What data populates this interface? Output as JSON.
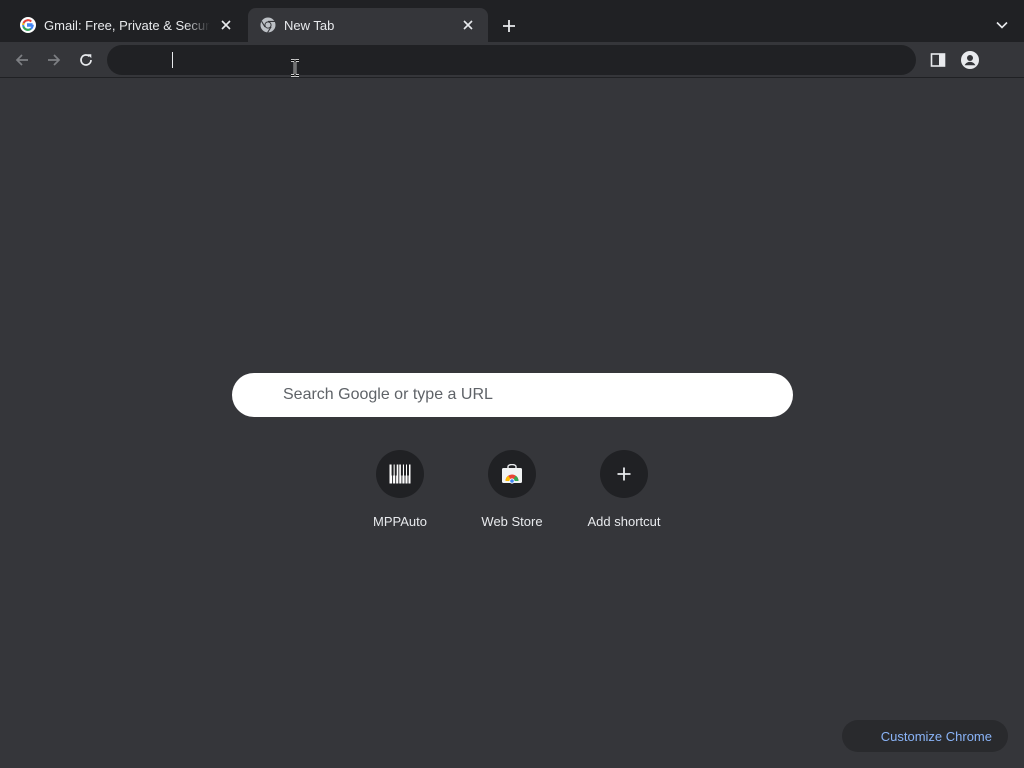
{
  "tabs": [
    {
      "title": "Gmail: Free, Private & Secure Email",
      "favicon": "google-g-icon",
      "active": false
    },
    {
      "title": "New Tab",
      "favicon": "chrome-icon",
      "active": true
    }
  ],
  "toolbar": {
    "back_icon": "arrow-left-icon",
    "forward_icon": "arrow-right-icon",
    "reload_icon": "reload-icon",
    "omnibox_value": "",
    "side_panel_icon": "side-panel-icon",
    "profile_icon": "person-icon"
  },
  "ntp": {
    "search_placeholder": "Search Google or type a URL",
    "shortcuts": [
      {
        "label": "MPPAuto",
        "icon": "piano-keys-icon"
      },
      {
        "label": "Web Store",
        "icon": "chrome-web-store-icon"
      },
      {
        "label": "Add shortcut",
        "icon": "plus-icon"
      }
    ],
    "customize_label": "Customize Chrome"
  },
  "colors": {
    "frame": "#202124",
    "page_background": "#35363a",
    "text": "#e8eaed",
    "link_blue": "#8ab4f8"
  }
}
